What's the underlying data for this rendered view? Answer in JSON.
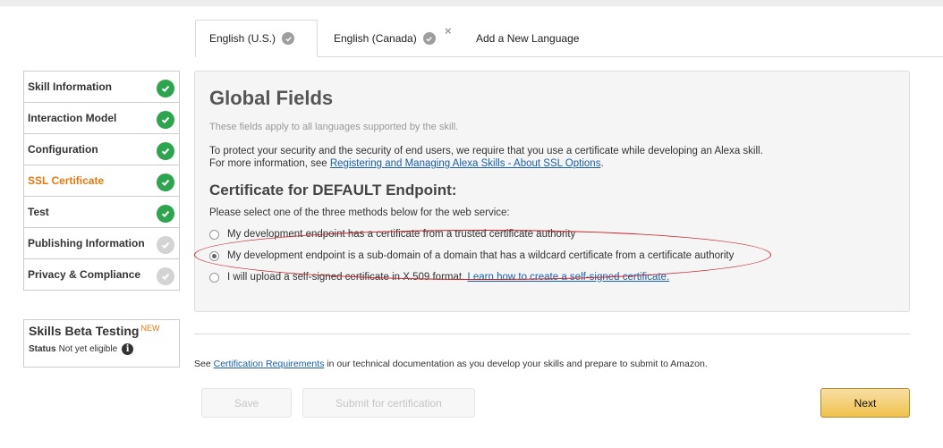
{
  "tabs": [
    {
      "label": "English (U.S.)",
      "active": true,
      "icon": "check-circle-icon"
    },
    {
      "label": "English (Canada)",
      "active": false,
      "icon": "check-circle-icon",
      "close": "×"
    },
    {
      "label": "Add a New Language",
      "active": false
    }
  ],
  "sidebar": {
    "items": [
      {
        "label": "Skill Information",
        "status": "complete"
      },
      {
        "label": "Interaction Model",
        "status": "complete"
      },
      {
        "label": "Configuration",
        "status": "complete"
      },
      {
        "label": "SSL Certificate",
        "status": "complete",
        "current": true
      },
      {
        "label": "Test",
        "status": "complete"
      },
      {
        "label": "Publishing Information",
        "status": "incomplete"
      },
      {
        "label": "Privacy & Compliance",
        "status": "incomplete"
      }
    ],
    "beta": {
      "title": "Skills Beta Testing",
      "badge": "NEW",
      "status_label": "Status",
      "status_value": "Not yet eligible",
      "info_icon": "i"
    }
  },
  "main": {
    "title": "Global Fields",
    "subtitle": "These fields apply to all languages supported by the skill.",
    "security_text": "To protect your security and the security of end users, we require that you use a certificate while developing an Alexa skill.",
    "more_info_prefix": "For more information, see ",
    "more_info_link": "Registering and Managing Alexa Skills - About SSL Options",
    "more_info_suffix": ".",
    "cert_heading": "Certificate for DEFAULT Endpoint:",
    "cert_prompt": "Please select one of the three methods below for the web service:",
    "options": [
      {
        "label": "My development endpoint has a certificate from a trusted certificate authority",
        "selected": false
      },
      {
        "label": "My development endpoint is a sub-domain of a domain that has a wildcard certificate from a certificate authority",
        "selected": true
      },
      {
        "label": "I will upload a self-signed certificate in X.509 format. ",
        "link": "Learn how to create a self-signed certificate.",
        "selected": false
      }
    ]
  },
  "footer": {
    "note_prefix": "See ",
    "note_link": "Certification Requirements",
    "note_suffix": " in our technical documentation as you develop your skills and prepare to submit to Amazon.",
    "save_label": "Save",
    "submit_label": "Submit for certification",
    "next_label": "Next"
  },
  "colors": {
    "complete": "#2ea44f",
    "incomplete": "#d3d3d3",
    "current": "#e47911",
    "link": "#1a5fa8",
    "annotation": "#c8202a"
  }
}
